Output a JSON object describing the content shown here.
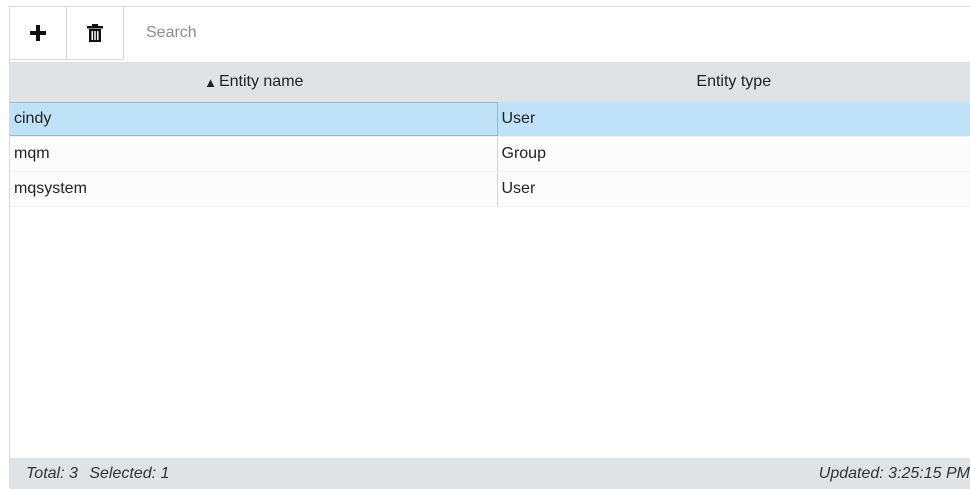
{
  "toolbar": {
    "add_icon": "plus-icon",
    "delete_icon": "trash-icon",
    "search": {
      "placeholder": "Search",
      "value": ""
    }
  },
  "table": {
    "columns": [
      {
        "label": "Entity name",
        "sort": "ascending",
        "sort_glyph": "▲"
      },
      {
        "label": "Entity type"
      }
    ],
    "rows": [
      {
        "name": "cindy",
        "type": "User",
        "selected": true
      },
      {
        "name": "mqm",
        "type": "Group",
        "selected": false
      },
      {
        "name": "mqsystem",
        "type": "User",
        "selected": false
      }
    ]
  },
  "footer": {
    "total": "Total: 3",
    "selected": "Selected: 1",
    "updated": "Updated: 3:25:15 PM"
  },
  "colors": {
    "header_bg": "#dfe3e6",
    "selected_row_bg": "#bfe2f8",
    "footer_bg": "#dfe3e6"
  }
}
